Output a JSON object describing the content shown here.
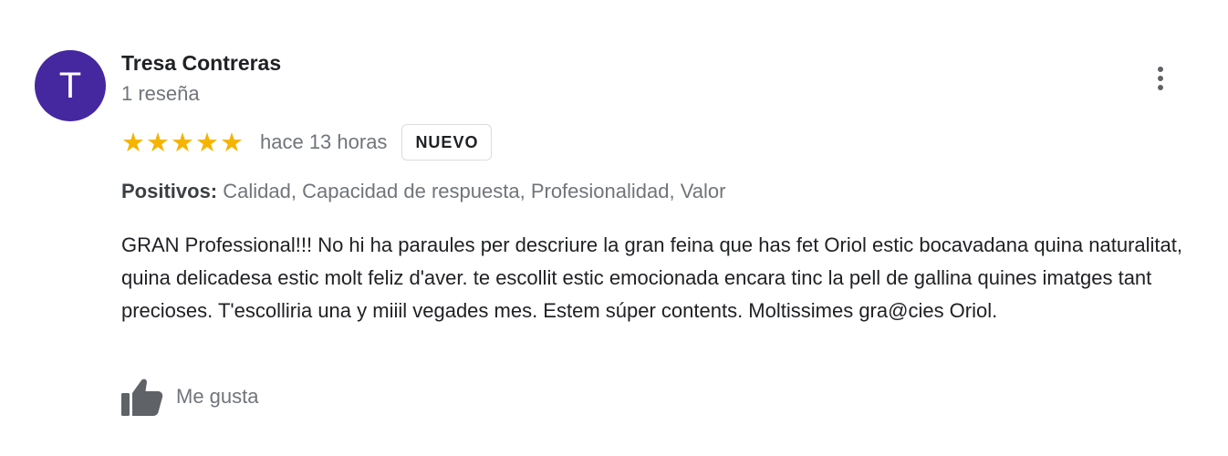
{
  "review": {
    "avatar_initial": "T",
    "avatar_color": "#4527a0",
    "author_name": "Tresa Contreras",
    "review_count": "1 reseña",
    "rating": 5,
    "stars": [
      "★",
      "★",
      "★",
      "★",
      "★"
    ],
    "time_ago": "hace 13 horas",
    "badge": "NUEVO",
    "positives_label": "Positivos:",
    "positives_values": "Calidad, Capacidad de respuesta, Profesionalidad, Valor",
    "text": "GRAN Professional!!! No hi ha paraules per descriure la gran feina que has fet Oriol estic bocavadana quina naturalitat, quina delicadesa estic molt feliz d'aver. te escollit estic emocionada encara tinc la pell de gallina quines imatges tant precioses. T'escolliria una y miiil vegades mes. Estem súper contents. Moltissimes gra@cies Oriol.",
    "like_label": "Me gusta",
    "more_icon": "more-vert-icon",
    "like_icon": "thumb-up-icon",
    "star_color": "#f4b400"
  }
}
